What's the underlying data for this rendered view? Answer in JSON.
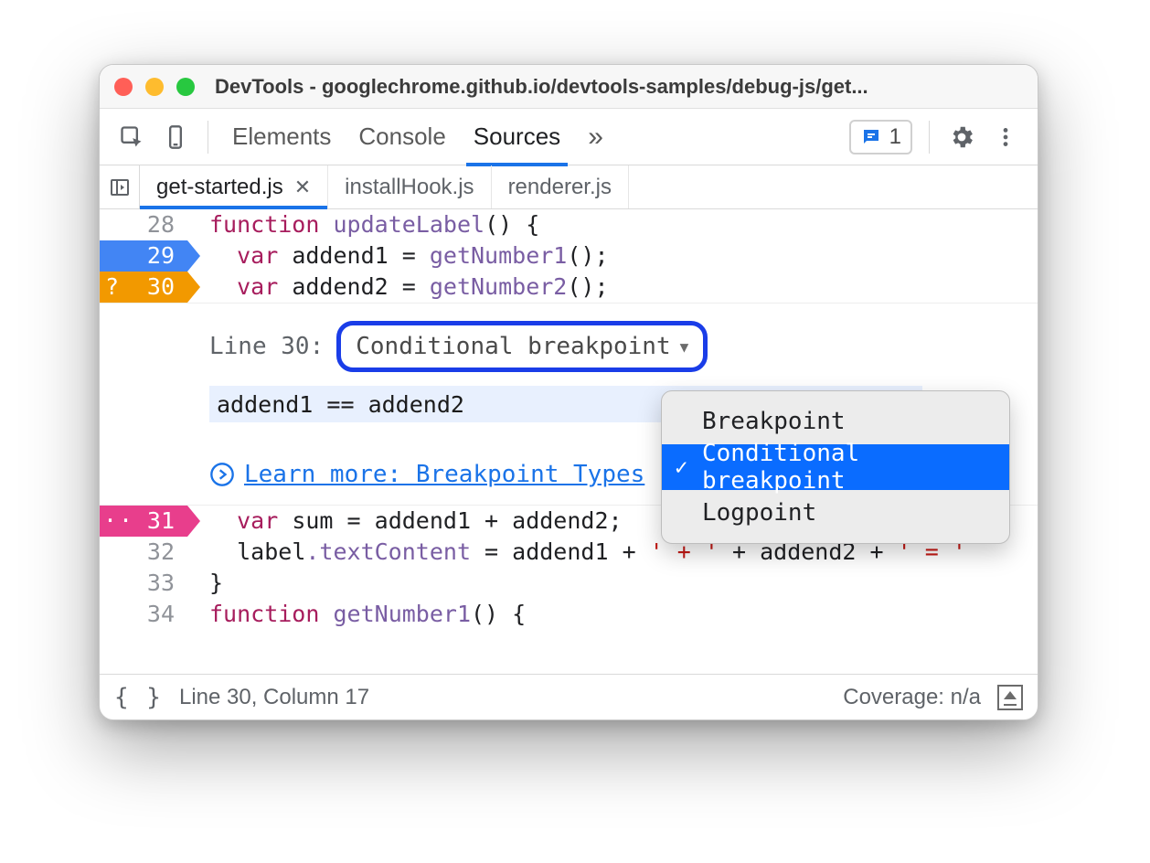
{
  "window_title": "DevTools - googlechrome.github.io/devtools-samples/debug-js/get...",
  "panels": {
    "elements": "Elements",
    "console": "Console",
    "sources": "Sources",
    "more_indicator": "»",
    "issues_count": "1"
  },
  "file_tabs": {
    "active": "get-started.js",
    "others": [
      "installHook.js",
      "renderer.js"
    ]
  },
  "code": {
    "l28": {
      "num": "28",
      "kw": "function",
      "fn": "updateLabel",
      "tail": "() {"
    },
    "l29": {
      "num": "29",
      "kw": "var",
      "name": "addend1",
      "eq": " = ",
      "call": "getNumber1",
      "tail": "();"
    },
    "l30": {
      "num": "30",
      "q": "?",
      "kw": "var",
      "name": "addend2",
      "eq": " = ",
      "call": "getNumber2",
      "tail": "();"
    },
    "l31": {
      "num": "31",
      "dots": "··",
      "kw": "var",
      "name": "sum",
      "eq": " = ",
      "expr": "addend1 + addend2;"
    },
    "l32": {
      "num": "32",
      "lhs": "label",
      "prop": ".textContent",
      "eq": " = ",
      "a": "addend1 + ",
      "s1": "' + '",
      "b": " + addend2 + ",
      "s2": "' = '"
    },
    "l33": {
      "num": "33",
      "text": "}"
    },
    "l34": {
      "num": "34",
      "kw": "function",
      "fn": "getNumber1",
      "tail": "() {"
    }
  },
  "bp_editor": {
    "line_label": "Line 30:",
    "select_value": "Conditional breakpoint",
    "expression": "addend1 == addend2",
    "learn_more": "Learn more: Breakpoint Types"
  },
  "popup": {
    "opt_breakpoint": "Breakpoint",
    "opt_conditional": "Conditional breakpoint",
    "opt_logpoint": "Logpoint"
  },
  "statusbar": {
    "position": "Line 30, Column 17",
    "coverage": "Coverage: n/a"
  }
}
